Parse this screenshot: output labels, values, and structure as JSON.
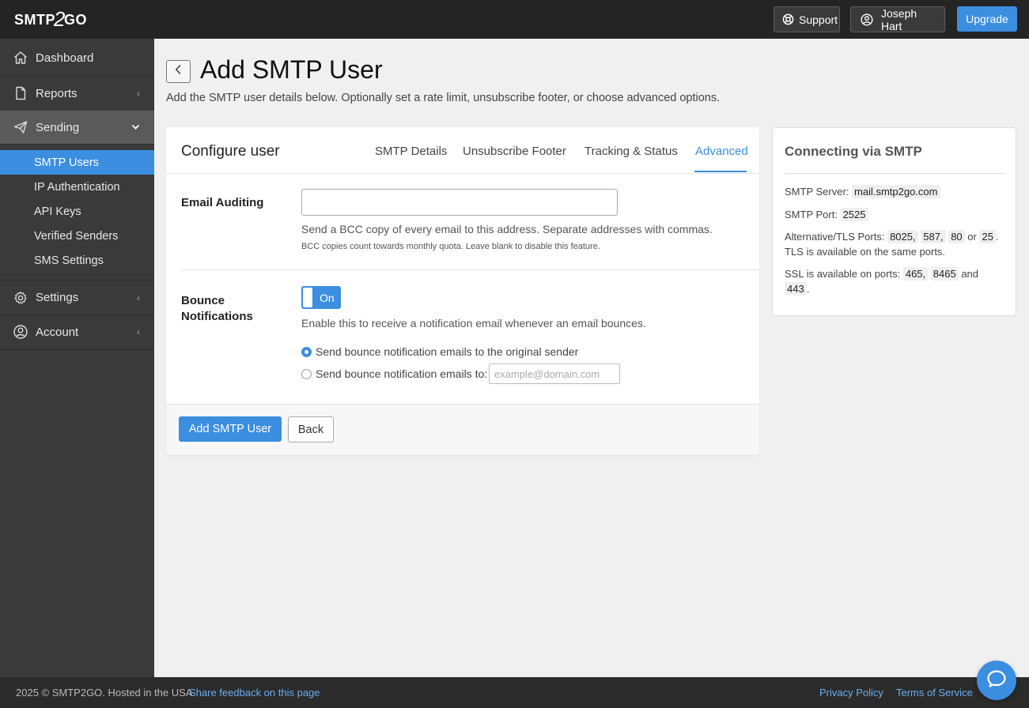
{
  "header": {
    "logo_text_a": "SMTP",
    "logo_text_b": "2",
    "logo_text_c": "GO",
    "support_label": "Support",
    "user_name": "Joseph Hart",
    "upgrade_label": "Upgrade"
  },
  "sidebar": {
    "items": [
      {
        "label": "Dashboard",
        "icon": "home-icon"
      },
      {
        "label": "Reports",
        "icon": "document-icon"
      },
      {
        "label": "Sending",
        "icon": "paper-plane-icon"
      },
      {
        "label": "Settings",
        "icon": "gear-icon"
      },
      {
        "label": "Account",
        "icon": "user-circle-icon"
      }
    ],
    "sending_subitems": [
      {
        "label": "SMTP Users",
        "selected": true
      },
      {
        "label": "IP Authentication"
      },
      {
        "label": "API Keys"
      },
      {
        "label": "Verified Senders"
      },
      {
        "label": "SMS Settings"
      }
    ]
  },
  "page": {
    "title": "Add SMTP User",
    "subtitle": "Add the SMTP user details below. Optionally set a rate limit, unsubscribe footer, or choose advanced options."
  },
  "configure": {
    "title": "Configure user",
    "tabs": [
      {
        "label": "SMTP Details"
      },
      {
        "label": "Unsubscribe Footer"
      },
      {
        "label": "Tracking & Status"
      },
      {
        "label": "Advanced",
        "active": true
      }
    ],
    "email_auditing": {
      "label": "Email Auditing",
      "value": "",
      "help": "Send a BCC copy of every email to this address. Separate addresses with commas.",
      "note": "BCC copies count towards monthly quota. Leave blank to disable this feature."
    },
    "bounce": {
      "label_line1": "Bounce",
      "label_line2": "Notifications",
      "toggle_label": "On",
      "help": "Enable this to receive a notification email whenever an email bounces.",
      "option1": "Send bounce notification emails to the original sender",
      "option2": "Send bounce notification emails to:",
      "email_placeholder": "example@domain.com"
    },
    "add_button": "Add SMTP User",
    "back_button": "Back"
  },
  "smtp_info": {
    "title": "Connecting via SMTP",
    "server_label": "SMTP Server:",
    "server": "mail.smtp2go.com",
    "port_label": "SMTP Port:",
    "port": "2525",
    "alt_label": "Alternative/TLS Ports:",
    "alt_ports": [
      "8025,",
      "587,",
      "80",
      "25"
    ],
    "alt_or": "or",
    "tls_note": "TLS is available on the same ports.",
    "ssl_label": "SSL is available on ports:",
    "ssl_ports": [
      "465,",
      "8465",
      "443"
    ],
    "ssl_and": "and"
  },
  "footer": {
    "copyright": "2025 © SMTP2GO. Hosted in the USA",
    "feedback": "Share feedback on this page",
    "privacy": "Privacy Policy",
    "terms": "Terms of Service"
  },
  "colors": {
    "accent": "#3b8ee0",
    "topbar": "#242424",
    "sidebar": "#3a3a3a"
  }
}
